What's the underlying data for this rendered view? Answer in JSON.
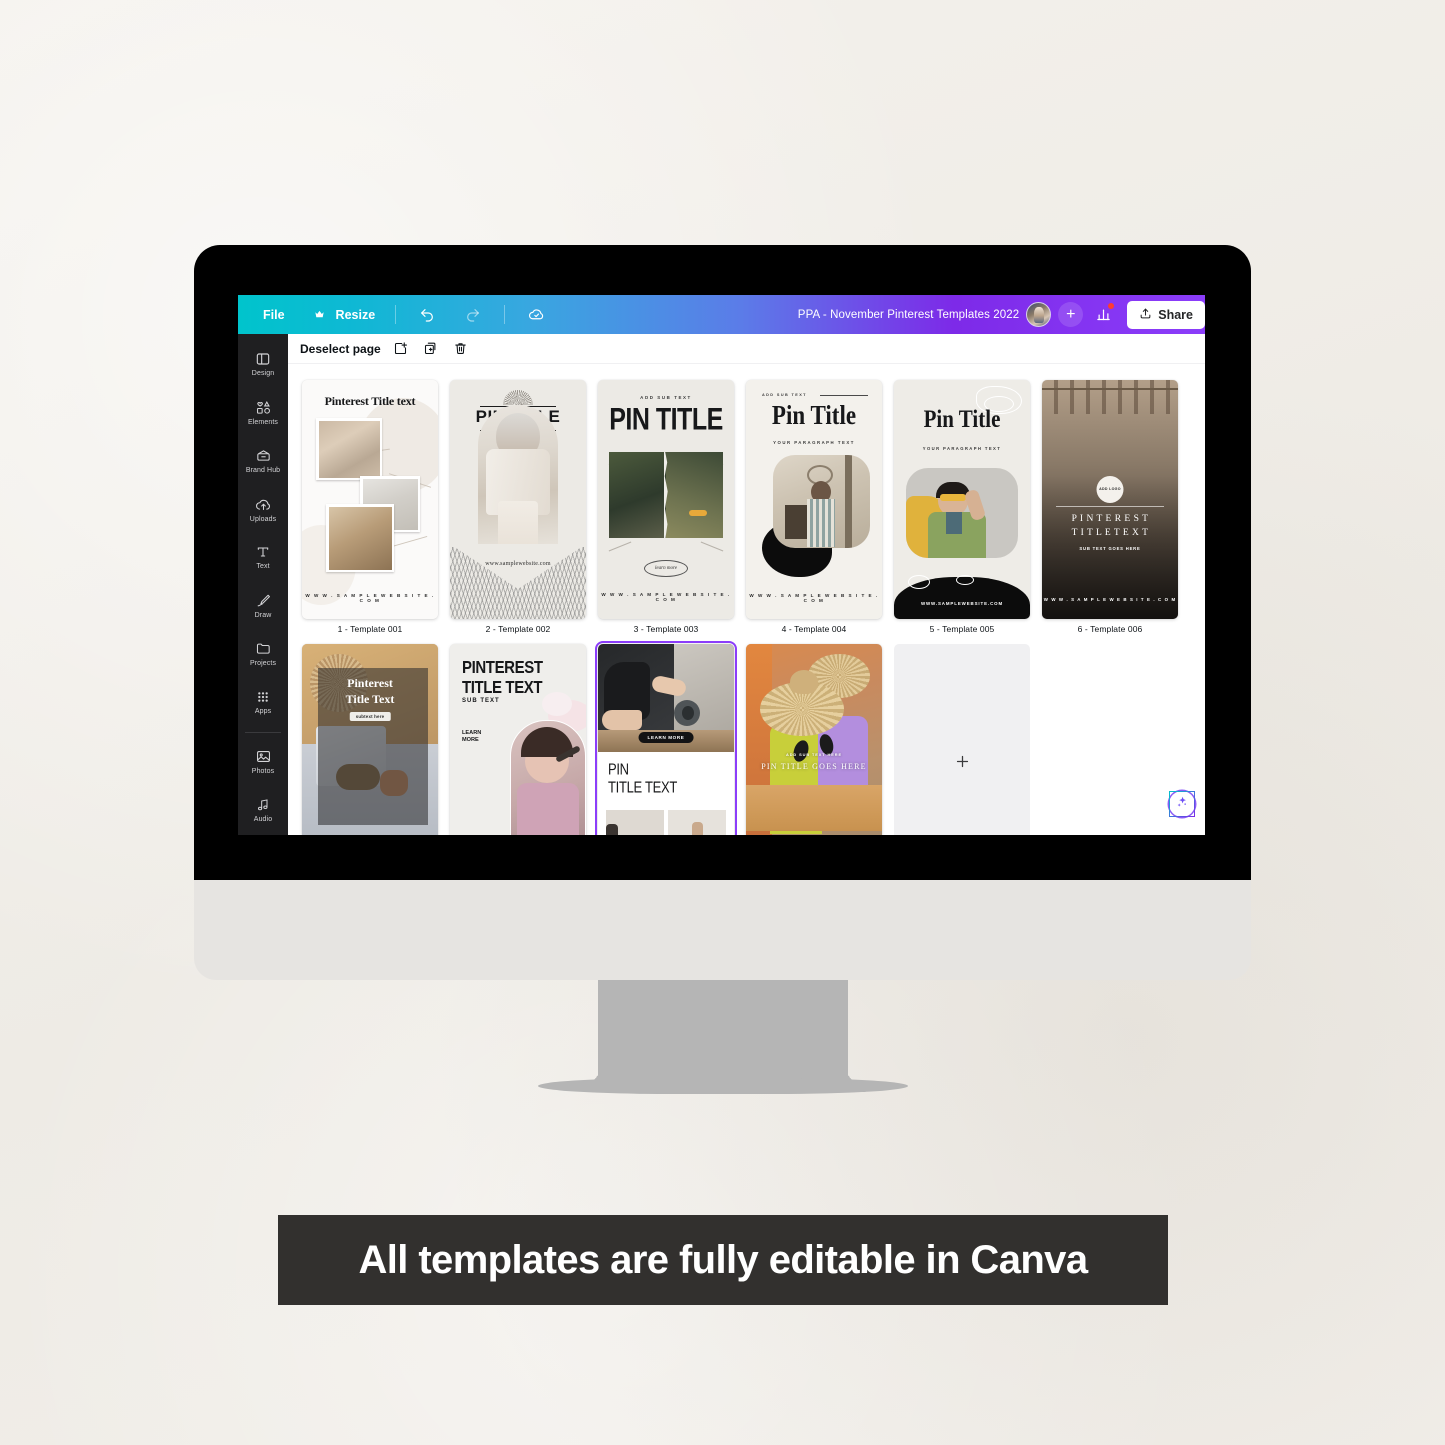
{
  "background": {
    "color": "#f1eee9"
  },
  "banner": {
    "text": "All templates are fully editable in Canva",
    "bg": "#32302e",
    "color": "#ffffff"
  },
  "app": {
    "topbar": {
      "file_label": "File",
      "resize_label": "Resize",
      "undo_icon": "undo-icon",
      "redo_icon": "redo-icon",
      "cloud_icon": "cloud-saved-icon",
      "doc_title": "PPA - November Pinterest Templates 2022",
      "avatar_icon": "avatar",
      "add_collaborator_label": "+",
      "stats_icon": "bar-chart-icon",
      "share_label": "Share",
      "share_icon": "share-upload-icon",
      "gradient_from": "#00c4cc",
      "gradient_to": "#8b3dfa"
    },
    "sidebar": {
      "items": [
        {
          "label": "Design",
          "icon": "layout-panel-icon"
        },
        {
          "label": "Elements",
          "icon": "shapes-icon"
        },
        {
          "label": "Brand Hub",
          "icon": "brand-hub-icon"
        },
        {
          "label": "Uploads",
          "icon": "upload-cloud-icon"
        },
        {
          "label": "Text",
          "icon": "text-t-icon"
        },
        {
          "label": "Draw",
          "icon": "pen-draw-icon"
        },
        {
          "label": "Projects",
          "icon": "folder-icon"
        },
        {
          "label": "Apps",
          "icon": "grid-dots-icon"
        },
        {
          "label": "Photos",
          "icon": "photo-icon"
        },
        {
          "label": "Audio",
          "icon": "music-note-icon"
        }
      ]
    },
    "subbar": {
      "deselect_label": "Deselect page",
      "add_page_icon": "add-page-icon",
      "duplicate_icon": "duplicate-page-icon",
      "delete_icon": "trash-icon"
    },
    "magic_button": {
      "icon": "magic-sparkle-icon",
      "accent": "#8b5cf6"
    },
    "pages": [
      {
        "caption": "1 - Template 001",
        "selected": false,
        "design": {
          "kind": "collage-sunglasses",
          "title": "Pinterest Title text",
          "website": "W W W . S A M P L E W E B S I T E . C O M"
        }
      },
      {
        "caption": "2 - Template 002",
        "selected": false,
        "design": {
          "kind": "pin-title-fashion",
          "title": "PIN TITLE",
          "website": "www.samplewebsite.com"
        }
      },
      {
        "caption": "3 - Template 003",
        "selected": false,
        "design": {
          "kind": "pin-title-torn-photo",
          "subtext": "ADD SUB TEXT",
          "title": "PIN TITLE",
          "cta": "learn more",
          "website": "W W W . S A M P L E W E B S I T E . C O M"
        }
      },
      {
        "caption": "4 - Template 004",
        "selected": false,
        "design": {
          "kind": "pin-title-blob",
          "subtext": "ADD SUB TEXT",
          "title": "Pin Title",
          "paragraph": "YOUR PARAGRAPH TEXT",
          "website": "W W W . S A M P L E W E B S I T E . C O M"
        }
      },
      {
        "caption": "5 - Template 005",
        "selected": false,
        "design": {
          "kind": "pin-title-green-jacket",
          "title": "Pin Title",
          "paragraph": "YOUR PARAGRAPH TEXT",
          "website": "WWW.SAMPLEWEBSITE.COM"
        }
      },
      {
        "caption": "6 - Template 006",
        "selected": false,
        "design": {
          "kind": "hangers-dark",
          "logo": "ADD LOGO",
          "title_line1": "P I N T E R E S T",
          "title_line2": "T I T L E   T E X T",
          "subtext": "SUB TEXT GOES HERE",
          "website": "W W W . S A M P L E W E B S I T E . C O M"
        }
      },
      {
        "caption": "",
        "selected": false,
        "design": {
          "kind": "hat-sunglasses-overlay",
          "title_line1": "Pinterest",
          "title_line2": "Title Text",
          "subtext": "subtext here"
        }
      },
      {
        "caption": "",
        "selected": false,
        "design": {
          "kind": "pinterest-sub-makeup",
          "title_line1": "PINTEREST",
          "title_line2": "TITLE TEXT",
          "subtext": "SUB TEXT",
          "cta_line1": "LEARN",
          "cta_line2": "MORE"
        }
      },
      {
        "caption": "",
        "selected": true,
        "design": {
          "kind": "yoga-mat",
          "cta": "LEARN MORE",
          "title_line1": "PIN",
          "title_line2": "TITLE TEXT"
        }
      },
      {
        "caption": "",
        "selected": false,
        "design": {
          "kind": "beach-hats",
          "subtext": "ADD SUB TEXT HERE",
          "title": "PIN TITLE GOES HERE"
        }
      },
      {
        "caption": "",
        "selected": false,
        "design": {
          "kind": "empty-add-page",
          "icon": "plus-icon"
        }
      }
    ]
  }
}
